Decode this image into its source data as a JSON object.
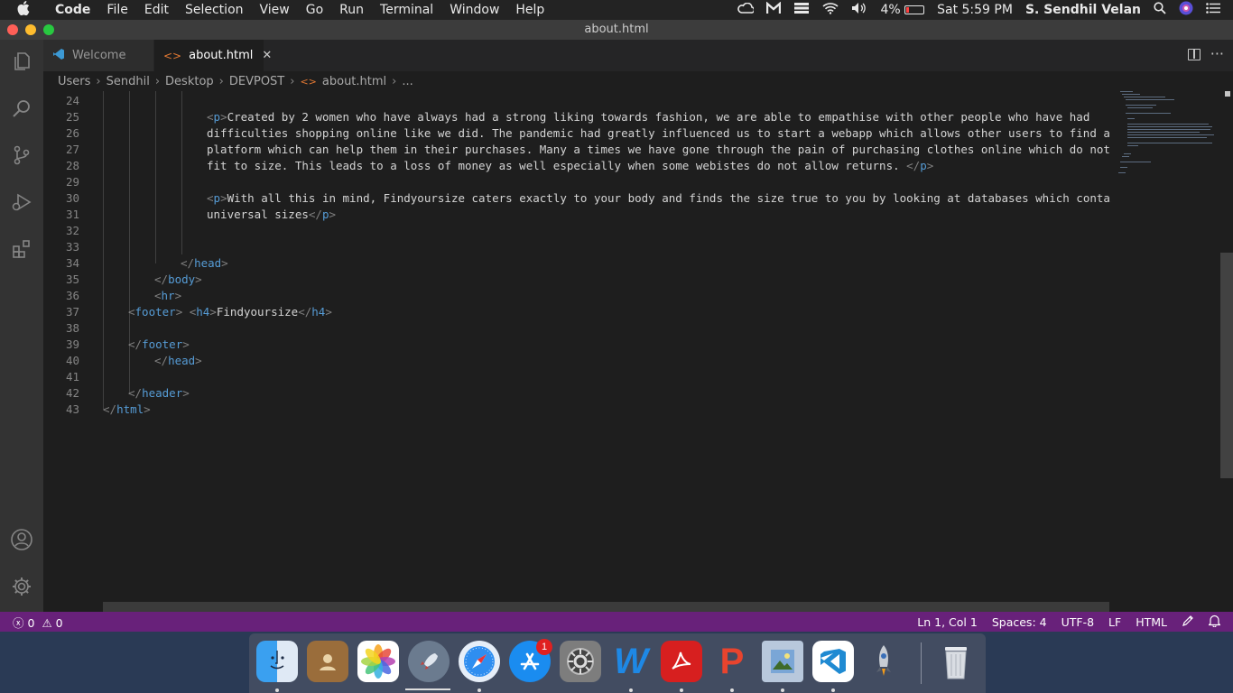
{
  "menubar": {
    "items": [
      "Code",
      "File",
      "Edit",
      "Selection",
      "View",
      "Go",
      "Run",
      "Terminal",
      "Window",
      "Help"
    ],
    "battery": "4%",
    "clock": "Sat 5:59 PM",
    "user": "S. Sendhil Velan"
  },
  "window": {
    "title": "about.html"
  },
  "tabs": [
    {
      "label": "Welcome",
      "icon": "vscode-logo-icon"
    },
    {
      "label": "about.html",
      "icon": "html-file-icon"
    }
  ],
  "breadcrumb": [
    "Users",
    "Sendhil",
    "Desktop",
    "DEVPOST",
    "about.html",
    "..."
  ],
  "editor": {
    "lines": [
      {
        "n": "24",
        "text": ""
      },
      {
        "n": "25",
        "text": "<p>Created by 2 women who have always had a strong liking towards fashion, we are able to empathise with other people who have had"
      },
      {
        "n": "26",
        "text": "difficulties shopping online like we did. The pandemic had greatly influenced us to start a webapp which allows other users to find a"
      },
      {
        "n": "27",
        "text": "platform which can help them in their purchases. Many a times we have gone through the pain of purchasing clothes online which do not"
      },
      {
        "n": "28",
        "text": "fit to size. This leads to a loss of money as well especially when some webistes do not allow returns. </p>"
      },
      {
        "n": "29",
        "text": ""
      },
      {
        "n": "30",
        "text": "<p>With all this in mind, Findyoursize caters exactly to your body and finds the size true to you by looking at databases which contain"
      },
      {
        "n": "31",
        "text": "universal sizes</p>"
      },
      {
        "n": "32",
        "text": ""
      },
      {
        "n": "33",
        "text": ""
      },
      {
        "n": "34",
        "text": "</head>"
      },
      {
        "n": "35",
        "text": "</body>"
      },
      {
        "n": "36",
        "text": "<hr>"
      },
      {
        "n": "37",
        "text": "<footer> <h4>Findyoursize</h4>"
      },
      {
        "n": "38",
        "text": ""
      },
      {
        "n": "39",
        "text": "</footer>"
      },
      {
        "n": "40",
        "text": "</head>"
      },
      {
        "n": "41",
        "text": ""
      },
      {
        "n": "42",
        "text": "</header>"
      },
      {
        "n": "43",
        "text": "</html>"
      }
    ]
  },
  "statusbar": {
    "errors": "0",
    "warnings": "0",
    "cursor": "Ln 1, Col 1",
    "spaces": "Spaces: 4",
    "encoding": "UTF-8",
    "eol": "LF",
    "language": "HTML"
  },
  "dock": {
    "apps": [
      {
        "name": "finder-icon",
        "label": ""
      },
      {
        "name": "contacts-icon",
        "label": ""
      },
      {
        "name": "photos-icon",
        "label": ""
      },
      {
        "name": "launchpad-icon",
        "label": ""
      },
      {
        "name": "safari-icon",
        "label": ""
      },
      {
        "name": "app-store-icon",
        "label": "",
        "badge": "1"
      },
      {
        "name": "system-preferences-icon",
        "label": ""
      },
      {
        "name": "word-icon",
        "label": "W"
      },
      {
        "name": "acrobat-icon",
        "label": ""
      },
      {
        "name": "powerpoint-icon",
        "label": "P"
      },
      {
        "name": "preview-icon",
        "label": ""
      },
      {
        "name": "vscode-icon",
        "label": ""
      },
      {
        "name": "rocket-icon",
        "label": ""
      },
      {
        "name": "trash-icon",
        "label": ""
      }
    ]
  },
  "colors": {
    "status_bar": "#68217a",
    "editor_bg": "#1e1e1e",
    "tag": "#569cd6"
  }
}
